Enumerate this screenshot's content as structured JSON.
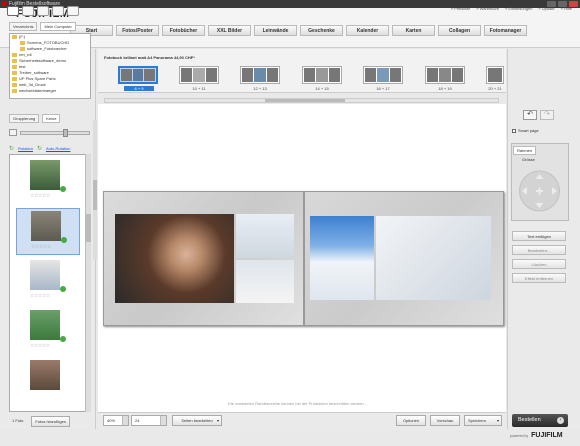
{
  "window": {
    "title": "Fujifilm Bestellsoftware"
  },
  "brand": {
    "logo": "FUJIFILM",
    "powered_by": "powered by",
    "powered_logo": "FUJIFILM"
  },
  "toplinks": [
    "» Preisliste",
    "» Warenkorb",
    "» Einstellungen",
    "» Update",
    "» Hilfe"
  ],
  "nav": {
    "tabs": [
      "Start",
      "Fotos/Poster",
      "Fotobücher",
      "XXL Bilder",
      "Leinwände",
      "Geschenke",
      "Kalender",
      "Karten",
      "Collagen",
      "Fotomanager"
    ]
  },
  "left": {
    "source_tabs": [
      "Verzeichnis",
      "Mein Computer"
    ],
    "folders": [
      {
        "label": "(F:)"
      },
      {
        "label": "Screens_FOTOBUCHD"
      },
      {
        "label": "software_Fotobuecher"
      },
      {
        "label": "ren_rdl"
      },
      {
        "label": "Sicherheitssoftware_demo"
      },
      {
        "label": "test"
      },
      {
        "label": "Treiber_software"
      },
      {
        "label": "UP Plus Spare Parts"
      },
      {
        "label": "web_3d_Druck"
      },
      {
        "label": "wechseldatentraeger"
      }
    ],
    "grouping": {
      "label": "Gruppierung",
      "value": "Keine"
    },
    "rotation_label": "Rotation",
    "auto_rotation_label": "Auto-Rotation",
    "photo_count": "1 Foto",
    "add_photos": "Fotos hinzufügen"
  },
  "strip": {
    "product": "Fotobuch brillant matt A4 Panorama 44,90 CHF*",
    "spreads": [
      "6 + 9",
      "10 + 11",
      "12 + 13",
      "14 + 15",
      "16 + 17",
      "18 + 19",
      "20 + 21"
    ],
    "selected_index": 0
  },
  "canvas": {
    "status": "Die markierten Randbereiche können bei der Produktion beschnitten werden..."
  },
  "bottombar": {
    "zoom": "40%",
    "page": "24",
    "edit_pages": "Seiten bearbeiten",
    "options": "Optionen",
    "preview": "Vorschau",
    "save": "Speichern"
  },
  "right": {
    "smart_page": "Smart page",
    "tabs": [
      "Rahmen"
    ],
    "size_label": "Grösse",
    "buttons": [
      "Text einfügen",
      "Bearbeiten...",
      "Löschen",
      "Effekt entfernen"
    ]
  },
  "order": {
    "label": "Bestellen"
  },
  "colors": {
    "accent": "#2e7bd6",
    "brand_red": "#cc0000"
  }
}
